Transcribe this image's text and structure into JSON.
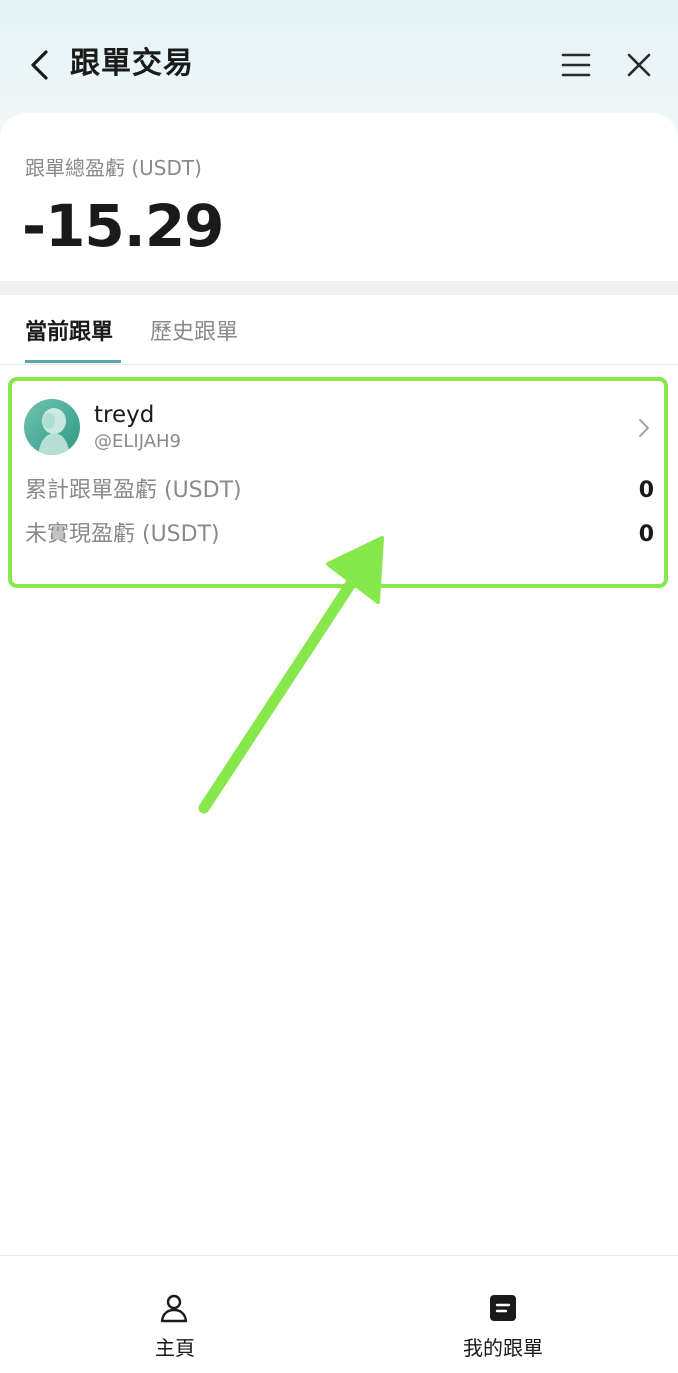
{
  "header": {
    "title": "跟單交易"
  },
  "summary": {
    "label": "跟單總盈虧 (USDT)",
    "value": "-15.29"
  },
  "tabs": [
    {
      "label": "當前跟單",
      "active": true
    },
    {
      "label": "歷史跟單",
      "active": false
    }
  ],
  "card": {
    "name": "treyd",
    "handle": "@ELIJAH9",
    "rows": [
      {
        "label": "累計跟單盈虧 (USDT)",
        "value": "0"
      },
      {
        "label": "未實現盈虧 (USDT)",
        "value": "0"
      }
    ],
    "highlight_color": "#86e84a"
  },
  "bottom_nav": [
    {
      "label": "主頁",
      "icon": "person-icon"
    },
    {
      "label": "我的跟單",
      "icon": "document-icon"
    }
  ],
  "colors": {
    "accent": "#5aa7ad",
    "annotation": "#86e84a",
    "muted_text": "#8a8a8a"
  }
}
